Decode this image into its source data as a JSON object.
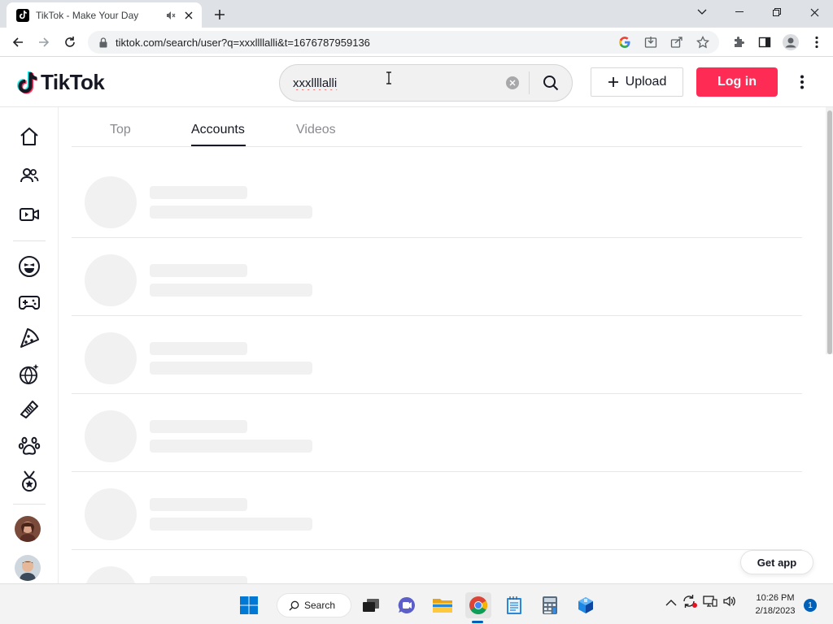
{
  "browser": {
    "tab_title": "TikTok - Make Your Day",
    "url": "tiktok.com/search/user?q=xxxllllalli&t=1676787959136"
  },
  "header": {
    "logo_text": "TikTok",
    "search_value": "xxxllllalli",
    "upload_label": "Upload",
    "login_label": "Log in"
  },
  "tabs": [
    {
      "label": "Top"
    },
    {
      "label": "Accounts"
    },
    {
      "label": "Videos"
    }
  ],
  "active_tab": "Accounts",
  "results_state": "loading",
  "get_app_label": "Get app",
  "taskbar": {
    "search_label": "Search",
    "time": "10:26 PM",
    "date": "2/18/2023",
    "notifications": "1"
  },
  "colors": {
    "brand": "#fe2c55",
    "text": "#161823",
    "skeleton": "#f1f1f2"
  },
  "sidebar_icons": [
    "home-icon",
    "following-icon",
    "live-icon",
    "comedy-icon",
    "gaming-icon",
    "food-icon",
    "dance-icon",
    "beauty-icon",
    "animals-icon",
    "sports-icon"
  ]
}
